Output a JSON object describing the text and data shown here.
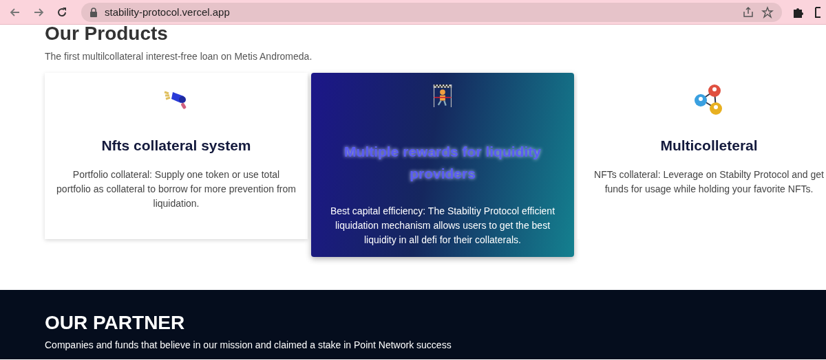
{
  "browser": {
    "url": "stability-protocol.vercel.app"
  },
  "products": {
    "title": "Our Products",
    "subtitle": "The first multilcollateral interest-free loan on Metis Andromeda.",
    "cards": [
      {
        "kind": "megaphone",
        "title": "Nfts collateral system",
        "text": "Portfolio collateral: Supply one token or use total portfolio as collateral to borrow for more prevention from liquidation.",
        "selected": false
      },
      {
        "kind": "finish",
        "title": "Multiple rewards for liquidity providers",
        "text": "Best capital efficiency: The Stabiltiy Protocol efficient liquidation mechanism allows users to get the best liquidity in all defi for their collaterals.",
        "selected": true
      },
      {
        "kind": "network",
        "title": "Multicolleteral",
        "text": "NFTs collateral: Leverage on Stabilty Protocol and get funds for usage while holding your favorite NFTs.",
        "selected": false
      }
    ]
  },
  "partner": {
    "title": "OUR PARTNER",
    "subtitle": "Companies and funds that believe in our mission and claimed a stake in Point Network success"
  }
}
